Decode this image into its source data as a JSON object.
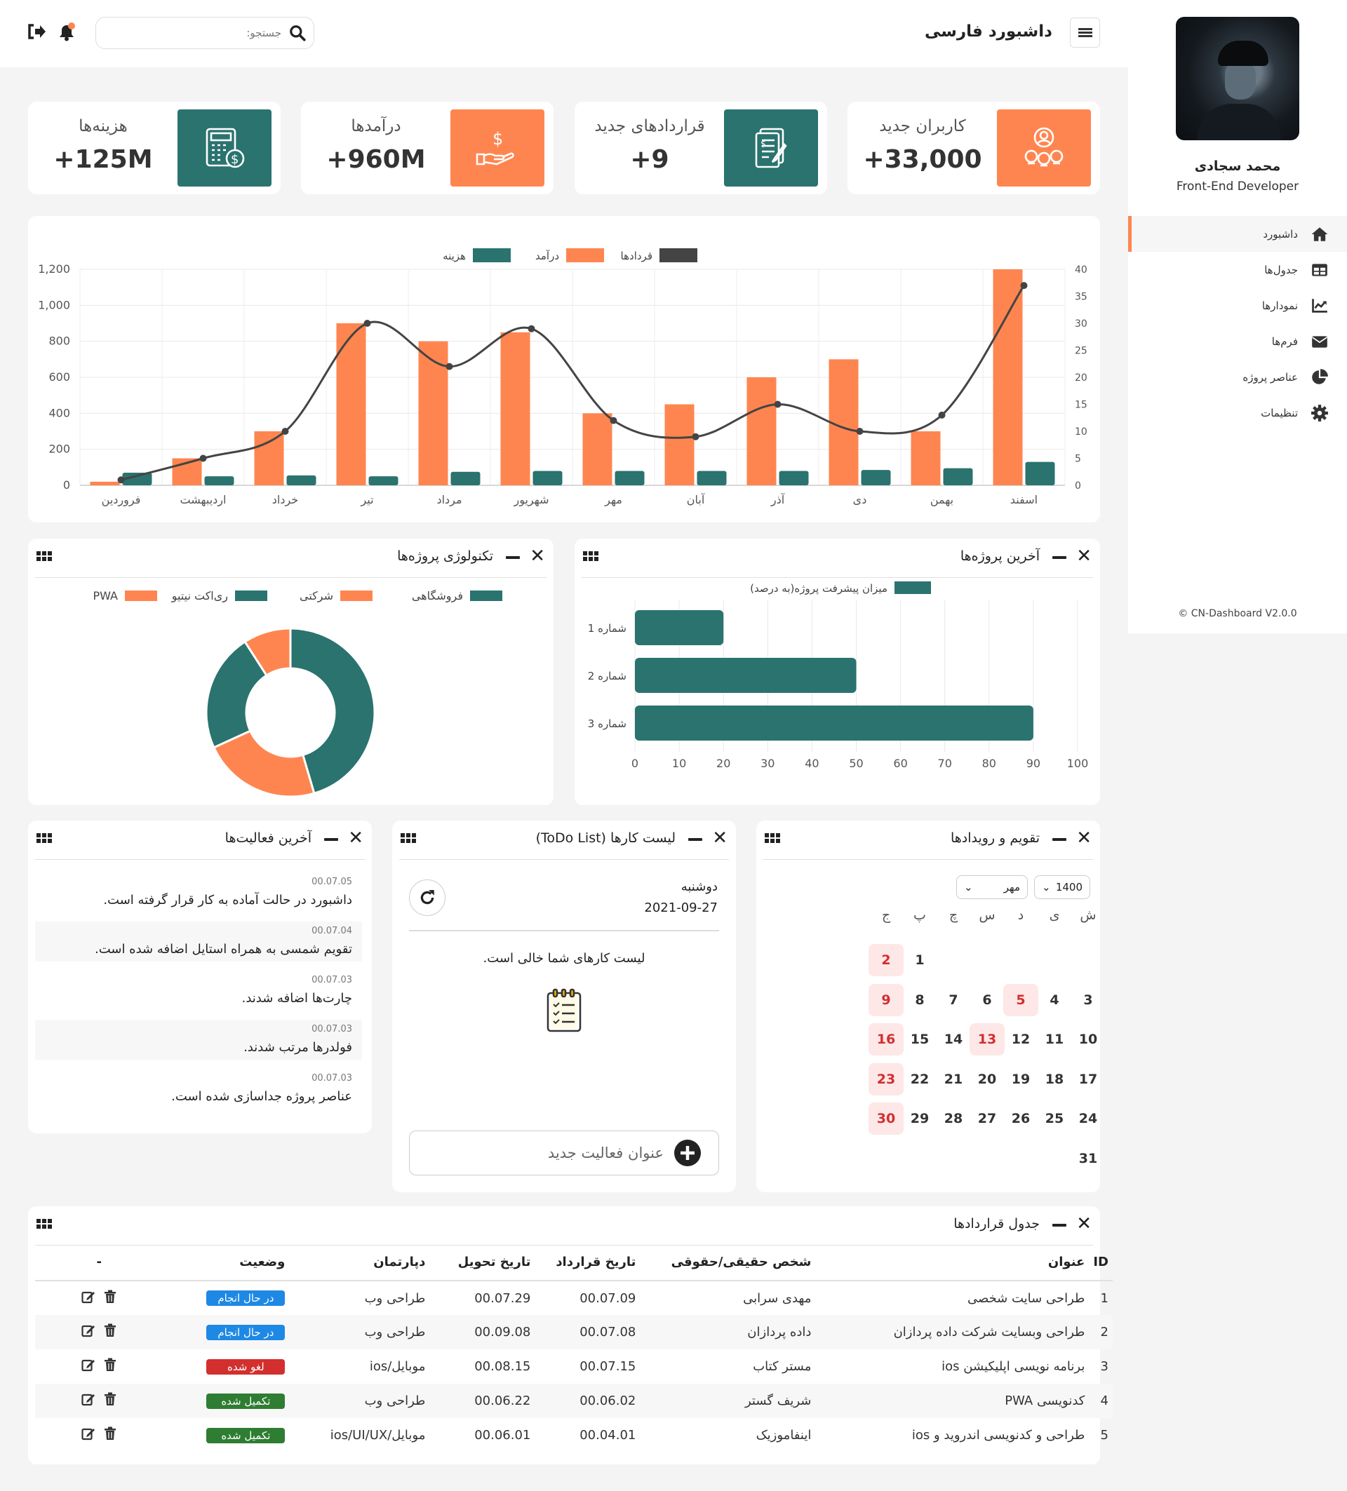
{
  "user": {
    "name": "محمد سجادی",
    "role": "Front-End Developer"
  },
  "menu": [
    {
      "label": "داشبورد",
      "icon": "home-icon"
    },
    {
      "label": "جدول‌ها",
      "icon": "table-icon"
    },
    {
      "label": "نمودارها",
      "icon": "chart-line-icon"
    },
    {
      "label": "فرم‌ها",
      "icon": "envelope-icon"
    },
    {
      "label": "عناصر پروژه",
      "icon": "pie-chart-icon"
    },
    {
      "label": "تنظیمات",
      "icon": "gear-icon"
    }
  ],
  "copyright": "© CN-Dashboard V2.0.0",
  "header": {
    "title": "داشبورد فارسی",
    "search_placeholder": "جستجو:"
  },
  "stats": [
    {
      "label": "کاربران جدید",
      "value": "+33,000",
      "color": "#ff8550",
      "icon": "users-icon"
    },
    {
      "label": "قراردادهای جدید",
      "value": "+9",
      "color": "#2a736f",
      "icon": "contract-icon"
    },
    {
      "label": "درآمدها",
      "value": "+960M",
      "color": "#ff8550",
      "icon": "hand-dollar-icon"
    },
    {
      "label": "هزینه‌ها",
      "value": "+125M",
      "color": "#2a736f",
      "icon": "calculator-icon"
    }
  ],
  "colors": {
    "accent": "#ff8550",
    "primary": "#2a736f",
    "dark": "#444444",
    "danger": "#d32f2f",
    "success": "#2e7d32",
    "info": "#1e88e5"
  },
  "chart_data": [
    {
      "type": "bar",
      "legend": [
        "قردادها",
        "درآمد",
        "هزینه"
      ],
      "categories": [
        "فروردین",
        "اردیبهشت",
        "خرداد",
        "تیر",
        "مرداد",
        "شهریور",
        "مهر",
        "آبان",
        "آذر",
        "دی",
        "بهمن",
        "اسفند"
      ],
      "series": [
        {
          "name": "درآمد",
          "type": "bar",
          "axis": "left",
          "color": "#ff8550",
          "values": [
            20,
            150,
            300,
            900,
            800,
            850,
            400,
            450,
            600,
            700,
            300,
            1200
          ]
        },
        {
          "name": "هزینه",
          "type": "bar",
          "axis": "left",
          "color": "#2a736f",
          "values": [
            70,
            50,
            55,
            50,
            75,
            80,
            80,
            80,
            80,
            85,
            95,
            130
          ]
        },
        {
          "name": "قردادها",
          "type": "line",
          "axis": "right",
          "color": "#444444",
          "values": [
            1,
            5,
            10,
            30,
            22,
            29,
            12,
            9,
            15,
            10,
            13,
            37
          ]
        }
      ],
      "ylim": [
        0,
        1200
      ],
      "yticks": [
        "0",
        "200",
        "400",
        "600",
        "800",
        "1,000",
        "1,200"
      ],
      "y2lim": [
        0,
        40
      ],
      "y2ticks": [
        "0",
        "5",
        "10",
        "15",
        "20",
        "25",
        "30",
        "35",
        "40"
      ],
      "legend_position": "top",
      "grid": true
    },
    {
      "type": "bar",
      "orientation": "horizontal",
      "title": "آخرین پروژه‌ها",
      "legend": [
        "میزان پیشرفت پروژه(به درصد)"
      ],
      "categories": [
        "شماره 1",
        "شماره 2",
        "شماره 3"
      ],
      "values": [
        20,
        50,
        90
      ],
      "xlim": [
        0,
        100
      ],
      "xticks": [
        "0",
        "10",
        "20",
        "30",
        "40",
        "50",
        "60",
        "70",
        "80",
        "90",
        "100"
      ],
      "grid": true
    },
    {
      "type": "pie",
      "variant": "doughnut",
      "title": "تکنولوژی پروژه‌ها",
      "labels": [
        "فروشگاهی",
        "شرکتی",
        "ری‌اکت نیتیو",
        "PWA"
      ],
      "values": [
        50,
        25,
        25,
        10
      ],
      "colors": [
        "#2a736f",
        "#ff8550",
        "#2a736f",
        "#ff8550"
      ],
      "legend_position": "top"
    }
  ],
  "panels": {
    "tech": "تکنولوژی پروژه‌ها",
    "latest": "آخرین پروژه‌ها",
    "activities": "آخرین فعالیت‌ها",
    "todo": "لیست کارها (ToDo List)",
    "calendar": "تقویم و رویدادها",
    "contracts": "جدول قراردادها"
  },
  "activities": [
    {
      "date": "00.07.05",
      "text": "داشبورد در حالت آماده به کار قرار گرفته است."
    },
    {
      "date": "00.07.04",
      "text": "تقویم شمسی به همراه استایل اضافه شده است."
    },
    {
      "date": "00.07.03",
      "text": "چارت‌ها اضافه شدند."
    },
    {
      "date": "00.07.03",
      "text": "فولدرها مرتب شدند."
    },
    {
      "date": "00.07.03",
      "text": "عناصر پروژه جداسازی شده است."
    }
  ],
  "todo": {
    "day": "دوشنبه",
    "date": "2021-09-27",
    "empty": "لیست کارهای شما خالی است.",
    "input_placeholder": "عنوان فعالیت جدید"
  },
  "calendar": {
    "year": "1400",
    "month": "مهر",
    "weekdays": [
      "ش",
      "ی",
      "د",
      "س",
      "چ",
      "پ",
      "ج"
    ],
    "days": [
      "1",
      "2",
      "3",
      "4",
      "5",
      "6",
      "7",
      "8",
      "9",
      "10",
      "11",
      "12",
      "13",
      "14",
      "15",
      "16",
      "17",
      "18",
      "19",
      "20",
      "21",
      "22",
      "23",
      "24",
      "25",
      "26",
      "27",
      "28",
      "29",
      "30",
      "31"
    ]
  },
  "table": {
    "headers": [
      "ID",
      "عنوان",
      "شخص حقیقی/حقوقی",
      "تاریخ قرارداد",
      "تاریخ تحویل",
      "دپارتمان",
      "وضعیت",
      "-"
    ],
    "rows": [
      {
        "id": "1",
        "title": "طراحی سایت شخصی",
        "person": "مهدی سرابی",
        "cdate": "00.07.09",
        "ddate": "00.07.29",
        "dept": "طراحی وب",
        "status": "در حال انجام",
        "status_color": "#1e88e5"
      },
      {
        "id": "2",
        "title": "طراحی وبسایت شرکت داده پردازان",
        "person": "داده پردازان",
        "cdate": "00.07.08",
        "ddate": "00.09.08",
        "dept": "طراحی وب",
        "status": "در حال انجام",
        "status_color": "#1e88e5"
      },
      {
        "id": "3",
        "title": "برنامه نویسی اپلیکیشن ios",
        "person": "مستر کتاب",
        "cdate": "00.07.15",
        "ddate": "00.08.15",
        "dept": "موبایل/ios",
        "status": "لغو شده",
        "status_color": "#d32f2f"
      },
      {
        "id": "4",
        "title": "کدنویسی PWA",
        "person": "شریف گستر",
        "cdate": "00.06.02",
        "ddate": "00.06.22",
        "dept": "طراحی وب",
        "status": "تکمیل شده",
        "status_color": "#2e7d32"
      },
      {
        "id": "5",
        "title": "طراحی و کدنویسی اندروید و ios",
        "person": "اینفاموزیک",
        "cdate": "00.04.01",
        "ddate": "00.06.01",
        "dept": "موبایل/ios/UI/UX",
        "status": "تکمیل شده",
        "status_color": "#2e7d32"
      }
    ]
  }
}
